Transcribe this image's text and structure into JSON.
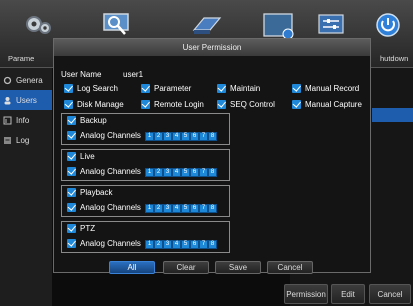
{
  "topbar": {
    "labels": {
      "parameter": "Parame",
      "shutdown": "hutdown"
    }
  },
  "sidebar": {
    "items": [
      {
        "label": "Genera"
      },
      {
        "label": "Users"
      },
      {
        "label": "Info"
      },
      {
        "label": "Log"
      }
    ]
  },
  "dialog": {
    "title": "User Permission",
    "user_name_label": "User Name",
    "user_name_value": "user1",
    "permissions": [
      {
        "label": "Log Search",
        "checked": true
      },
      {
        "label": "Parameter",
        "checked": true
      },
      {
        "label": "Maintain",
        "checked": true
      },
      {
        "label": "Manual Record",
        "checked": true
      },
      {
        "label": "Disk Manage",
        "checked": true
      },
      {
        "label": "Remote Login",
        "checked": true
      },
      {
        "label": "SEQ Control",
        "checked": true
      },
      {
        "label": "Manual Capture",
        "checked": true
      }
    ],
    "groups": [
      {
        "label": "Backup",
        "channels_label": "Analog Channels",
        "channels": [
          "1",
          "2",
          "3",
          "4",
          "5",
          "6",
          "7",
          "8"
        ]
      },
      {
        "label": "Live",
        "channels_label": "Analog Channels",
        "channels": [
          "1",
          "2",
          "3",
          "4",
          "5",
          "6",
          "7",
          "8"
        ]
      },
      {
        "label": "Playback",
        "channels_label": "Analog Channels",
        "channels": [
          "1",
          "2",
          "3",
          "4",
          "5",
          "6",
          "7",
          "8"
        ]
      },
      {
        "label": "PTZ",
        "channels_label": "Analog Channels",
        "channels": [
          "1",
          "2",
          "3",
          "4",
          "5",
          "6",
          "7",
          "8"
        ]
      }
    ],
    "buttons": {
      "all": "All",
      "clear": "Clear",
      "save": "Save",
      "cancel": "Cancel"
    }
  },
  "bottom_buttons": {
    "permission": "Permission",
    "edit": "Edit",
    "cancel": "Cancel"
  },
  "colors": {
    "accent": "#1e5cae",
    "checkbox": "#1f88d8",
    "dialog_bg": "#141414"
  }
}
